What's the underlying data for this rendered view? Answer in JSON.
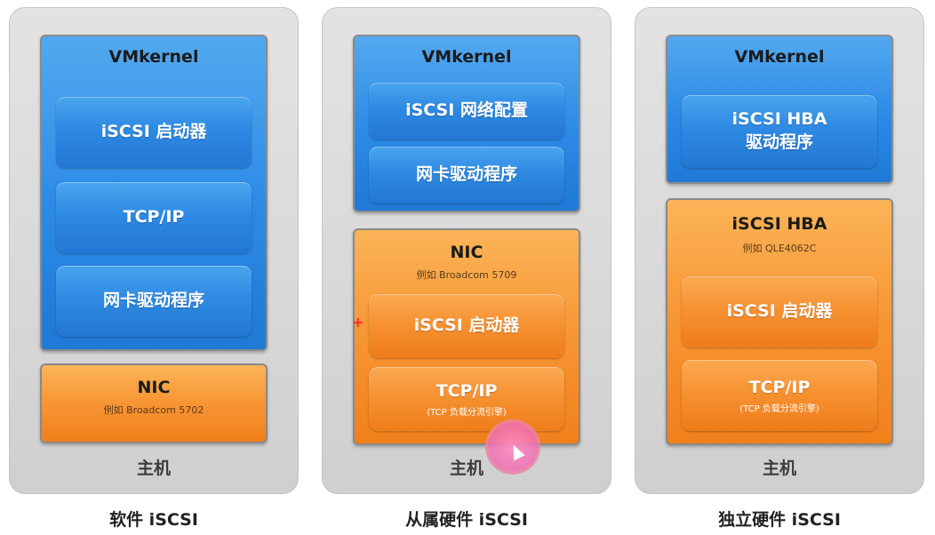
{
  "columns": [
    {
      "caption": "软件 iSCSI",
      "host_label": "主机",
      "top_panel": {
        "title": "VMkernel",
        "items": [
          "iSCSI 启动器",
          "TCP/IP",
          "网卡驱动程序"
        ]
      },
      "bottom_panel": {
        "title": "NIC",
        "subtitle": "例如 Broadcom 5702"
      }
    },
    {
      "caption": "从属硬件 iSCSI",
      "host_label": "主机",
      "top_panel": {
        "title": "VMkernel",
        "items": [
          "iSCSI 网络配置",
          "网卡驱动程序"
        ]
      },
      "bottom_panel": {
        "title": "NIC",
        "subtitle": "例如 Broadcom 5709",
        "items": [
          {
            "label": "iSCSI 启动器"
          },
          {
            "label": "TCP/IP",
            "sub": "(TCP 负载分流引擎)"
          }
        ]
      }
    },
    {
      "caption": "独立硬件 iSCSI",
      "host_label": "主机",
      "top_panel": {
        "title": "VMkernel",
        "items": [
          "iSCSI HBA\n驱动程序"
        ]
      },
      "bottom_panel": {
        "title": "iSCSI HBA",
        "subtitle": "例如 QLE4062C",
        "items": [
          {
            "label": "iSCSI 启动器"
          },
          {
            "label": "TCP/IP",
            "sub": "(TCP 负载分流引擎)"
          }
        ]
      }
    }
  ],
  "colors": {
    "blue": "#2c8ae6",
    "orange": "#f79533",
    "host_bg": "#dcdcdc"
  }
}
